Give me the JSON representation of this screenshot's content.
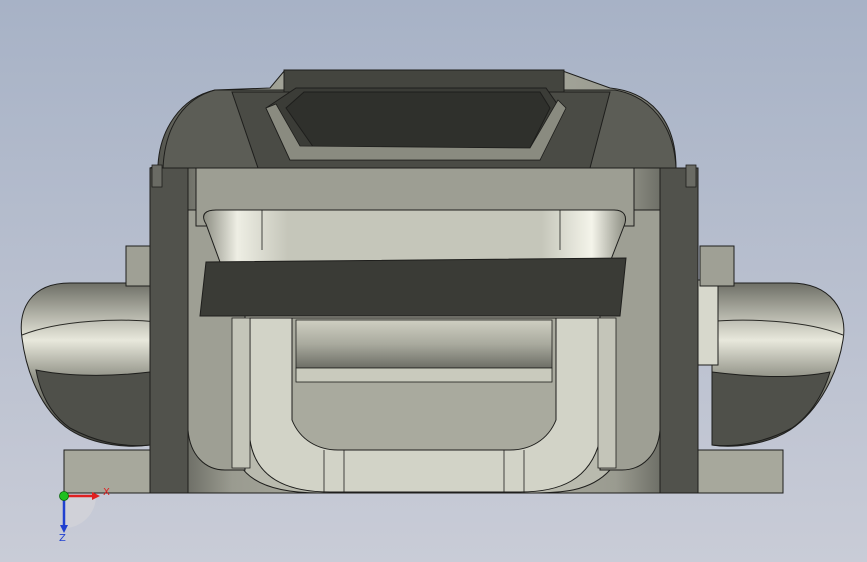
{
  "colors": {
    "background_top": "#a9b4c8",
    "background_bottom": "#c7cbd6",
    "dark_face": "#3a3a36",
    "mid_face": "#8a8b80",
    "light_face": "#c8c8b8",
    "edge": "#1e1e1c",
    "axis_x": "#e02020",
    "axis_y": "#20c020",
    "axis_z": "#2040d0"
  },
  "triad": {
    "x_label": "X",
    "z_label": "Z",
    "x_icon": "x-axis-arrow-icon",
    "y_icon": "y-axis-dot-icon",
    "z_icon": "z-axis-arrow-icon"
  },
  "model": {
    "name_icon": "3d-part-model-icon"
  }
}
